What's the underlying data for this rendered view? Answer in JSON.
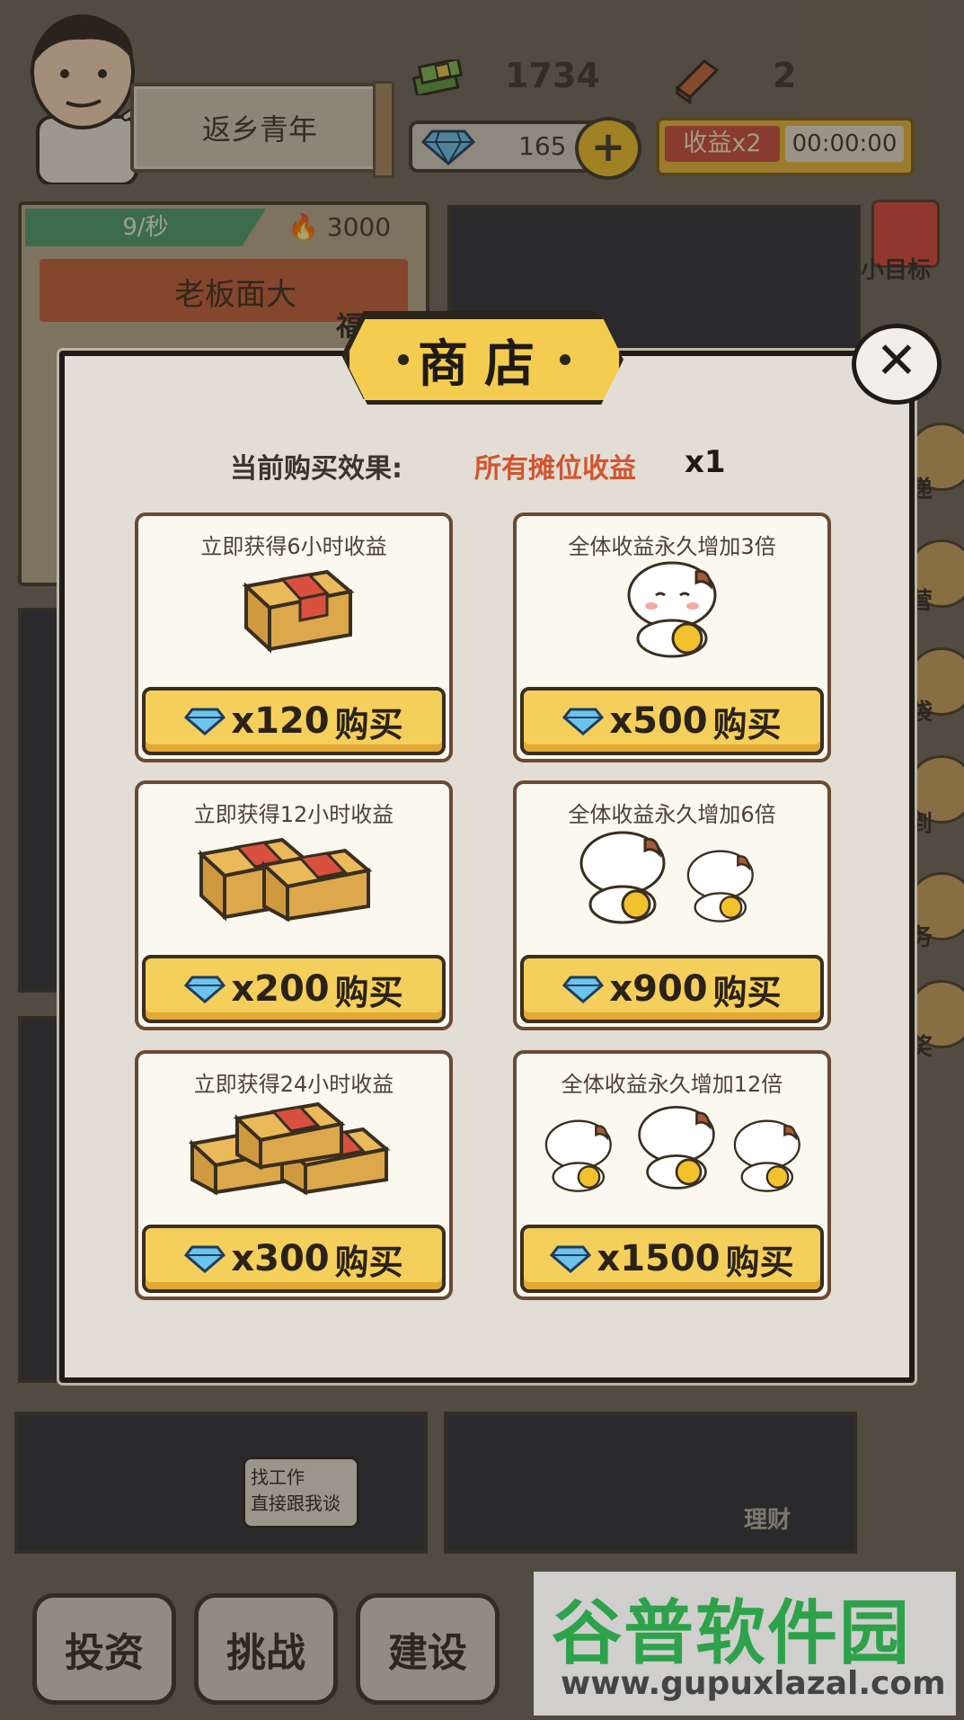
{
  "hud": {
    "player_name": "返乡青年",
    "money": "1734",
    "bricks": "2",
    "gems": "165",
    "plus_label": "+",
    "boost_label": "收益x2",
    "boost_timer": "00:00:00"
  },
  "stall": {
    "rate": "9/秒",
    "popularity": "3000",
    "banner_text": "老板面大",
    "welfare": "福利"
  },
  "side_menu": {
    "items": [
      "小目标",
      "递",
      "营",
      "袋",
      "到",
      "务",
      "奖"
    ]
  },
  "background_scene": {
    "speech_line1": "找工作",
    "speech_line2": "直接跟我谈",
    "sign": "理财"
  },
  "bottom_bar": {
    "invest": "投资",
    "challenge": "挑战",
    "build": "建设"
  },
  "watermark": {
    "title": "谷普软件园",
    "url": "www.gupuxlazal.com"
  },
  "shop": {
    "title_char1": "商",
    "title_char2": "店",
    "close_label": "✕",
    "effect_label": "当前购买效果:",
    "effect_value": "所有摊位收益",
    "effect_multiplier": "x1",
    "buy_label": "购买",
    "items": [
      {
        "title": "立即获得6小时收益",
        "price": "x120"
      },
      {
        "title": "全体收益永久增加3倍",
        "price": "x500"
      },
      {
        "title": "立即获得12小时收益",
        "price": "x200"
      },
      {
        "title": "全体收益永久增加6倍",
        "price": "x900"
      },
      {
        "title": "立即获得24小时收益",
        "price": "x300"
      },
      {
        "title": "全体收益永久增加12倍",
        "price": "x1500"
      }
    ]
  },
  "colors": {
    "accent_yellow": "#f5cf5b",
    "effect_orange": "#d2552d",
    "card_border": "#6b4a33",
    "boost_red": "#c84b3a"
  }
}
